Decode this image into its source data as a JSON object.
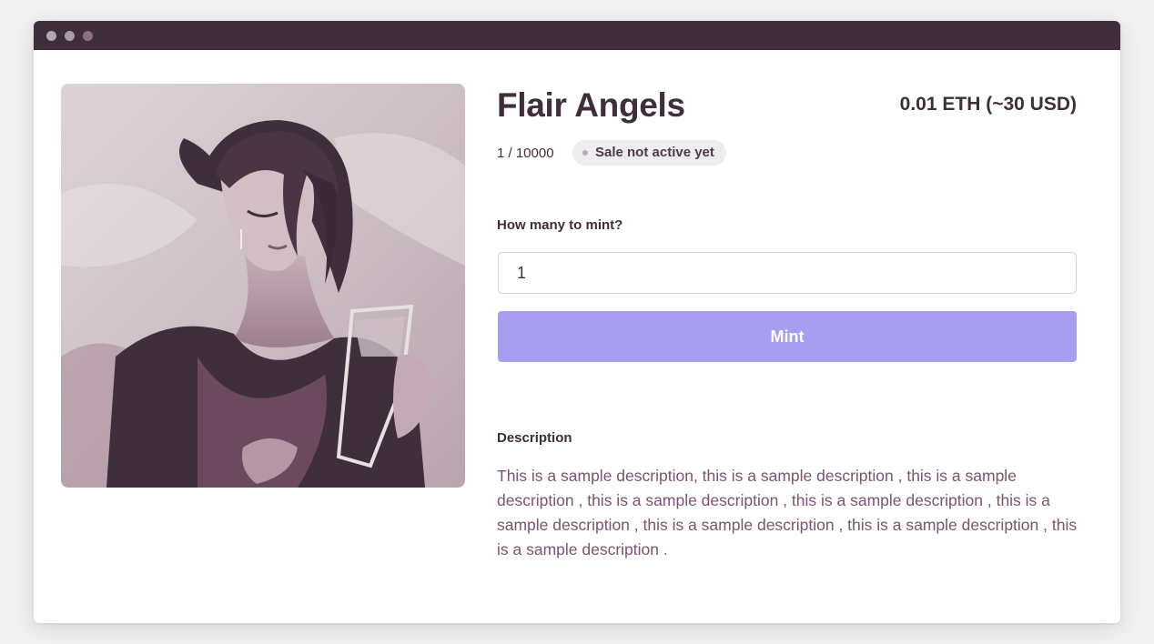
{
  "theme": {
    "titlebar": "#3f2e3b",
    "text_primary": "#3f2e3b",
    "text_description": "#7a5470",
    "badge_background": "#eeecee",
    "badge_dot": "#b9afb7",
    "button_background": "#a89ef0",
    "button_text": "#ffffff"
  },
  "window": {
    "controls": [
      {
        "name": "close",
        "color": "#b4a9b2"
      },
      {
        "name": "minimize",
        "color": "#a89ca6"
      },
      {
        "name": "zoom",
        "color": "#8a6f85"
      }
    ]
  },
  "artwork": {
    "icon": "nft-artwork-image",
    "palette": [
      "#d9cfd3",
      "#3f2e3b",
      "#7c5a6f",
      "#b596a4"
    ]
  },
  "product": {
    "title": "Flair Angels",
    "price": "0.01 ETH (~30 USD)",
    "supply": "1 / 10000",
    "status": "Sale not active yet"
  },
  "mint": {
    "label": "How many to mint?",
    "quantity": "1",
    "button_label": "Mint"
  },
  "description": {
    "heading": "Description",
    "text": "This is a sample description, this is a sample description , this is a sample description , this is a sample description , this is a sample description , this is a sample description , this is a sample description , this is a sample description , this is a sample description ."
  }
}
